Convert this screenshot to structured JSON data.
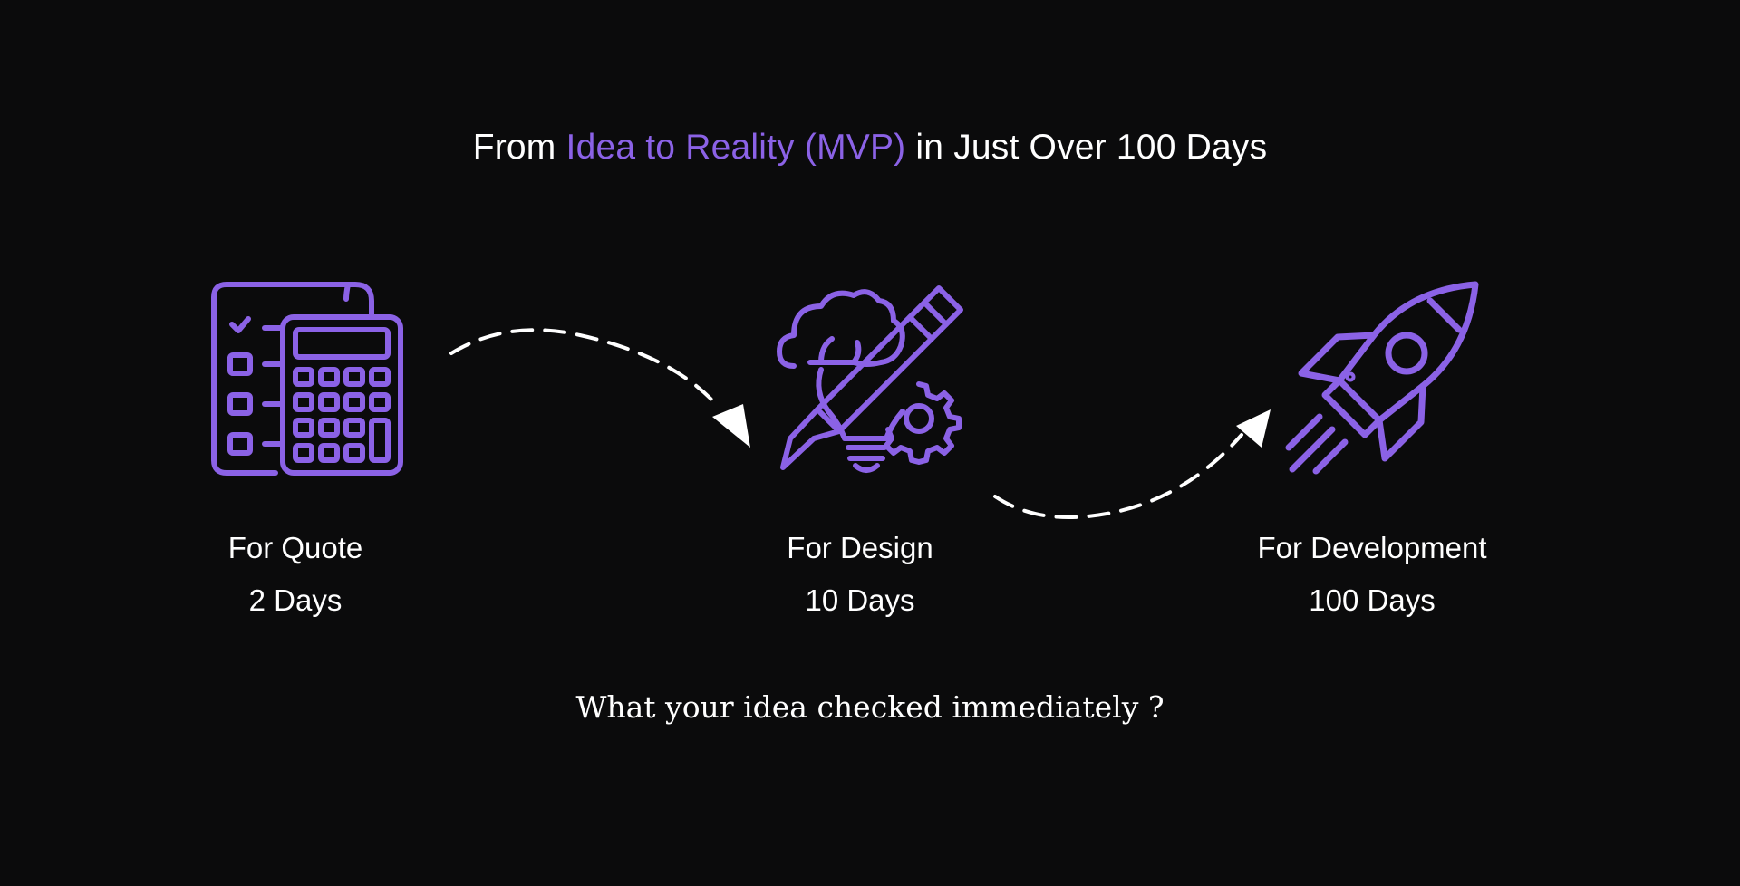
{
  "headline": {
    "prefix": "From ",
    "highlight": "Idea to Reality (MVP)",
    "suffix": " in Just Over 100 Days"
  },
  "steps": [
    {
      "icon": "calculator-checklist-icon",
      "title": "For Quote",
      "duration": "2 Days"
    },
    {
      "icon": "idea-bulb-pencil-gear-icon",
      "title": "For Design",
      "duration": "10 Days"
    },
    {
      "icon": "rocket-icon",
      "title": "For Development",
      "duration": "100 Days"
    }
  ],
  "footer": "What your idea checked immediately ?",
  "colors": {
    "background": "#0b0b0c",
    "accent": "#8b62e6",
    "text": "#ffffff"
  }
}
